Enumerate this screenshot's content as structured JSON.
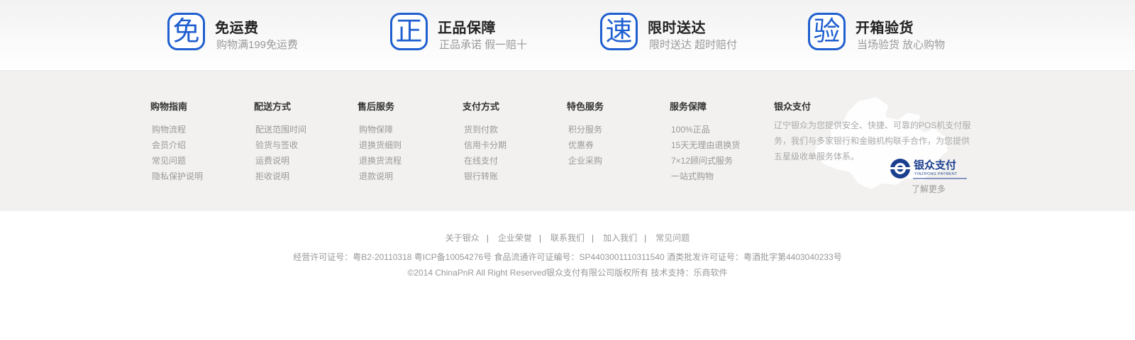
{
  "promises": [
    {
      "icon": "免",
      "icon_name": "free-shipping-icon",
      "title": "免运费",
      "subtitle": "购物满199免运费"
    },
    {
      "icon": "正",
      "icon_name": "genuine-icon",
      "title": "正品保障",
      "subtitle": "正品承诺 假一赔十"
    },
    {
      "icon": "速",
      "icon_name": "fast-delivery-icon",
      "title": "限时送达",
      "subtitle": "限时送达 超时赔付"
    },
    {
      "icon": "验",
      "icon_name": "inspect-icon",
      "title": "开箱验货",
      "subtitle": "当场验货 放心购物"
    }
  ],
  "columns": [
    {
      "title": "购物指南",
      "items": [
        "购物流程",
        "会员介绍",
        "常见问题",
        "隐私保护说明"
      ]
    },
    {
      "title": "配送方式",
      "items": [
        "配送范围时间",
        "验货与签收",
        "运费说明",
        "拒收说明"
      ]
    },
    {
      "title": "售后服务",
      "items": [
        "购物保障",
        "退换货细则",
        "退换货流程",
        "退款说明"
      ]
    },
    {
      "title": "支付方式",
      "items": [
        "货到付款",
        "信用卡分期",
        "在线支付",
        "银行转账"
      ]
    },
    {
      "title": "特色服务",
      "items": [
        "积分服务",
        "优惠券",
        "企业采购"
      ]
    },
    {
      "title": "服务保障",
      "items": [
        "100%正品",
        "15天无理由退换货",
        "7×12顾问式服务",
        "一站式购物"
      ]
    }
  ],
  "yinzhong": {
    "title": "银众支付",
    "description": "辽宁银众为您提供安全、快捷、可靠的POS机支付服务，我们与多家银行和金融机构联手合作，为您提供五星级收单服务体系。",
    "logo_text": "银众支付",
    "logo_subtext": "YINZHONG PAYMENT",
    "more_link": "了解更多"
  },
  "bottom_nav": [
    "关于银众",
    "企业荣誉",
    "联系我们",
    "加入我们",
    "常见问题"
  ],
  "nav_separator": "|",
  "license_line": "经营许可证号：粤B2-20110318 粤ICP备10054276号 食品流通许可证编号：SP4403001110311540 酒类批发许可证号：粤酒批字第4403040233号",
  "copyright_line": "©2014 ChinaPnR All Right Reserved银众支付有限公司版权所有 技术支持：乐商软件",
  "colors": {
    "accent": "#1f5fcf",
    "band": "#f2f1ef"
  }
}
